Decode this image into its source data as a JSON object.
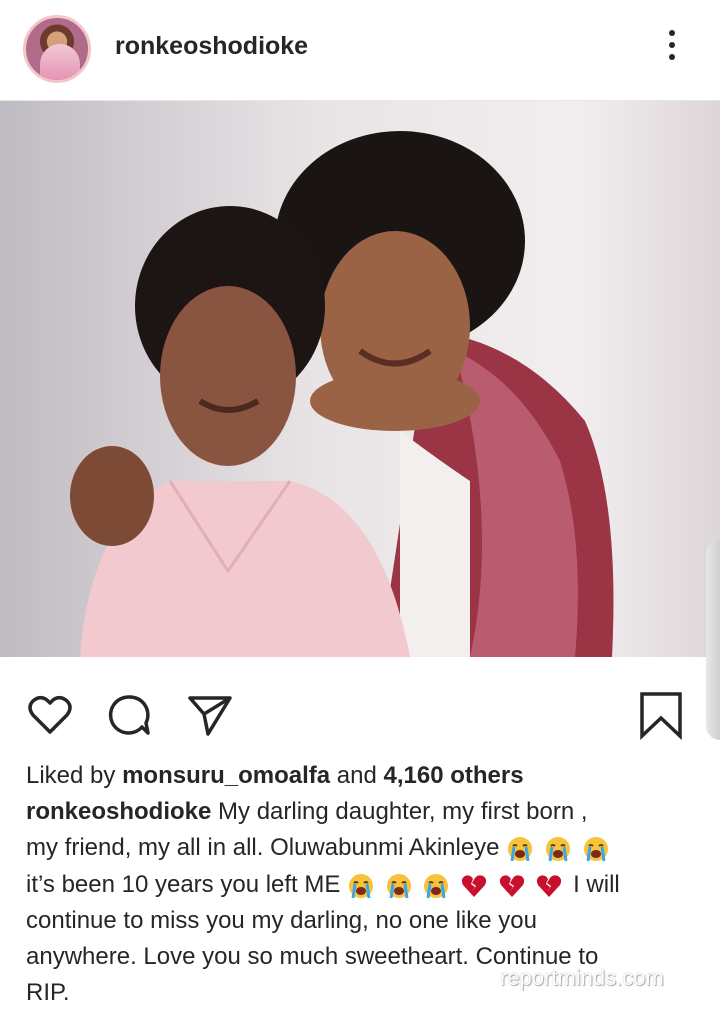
{
  "post": {
    "username": "ronkeoshodioke"
  },
  "likes": {
    "prefix": "Liked by",
    "user": "monsuru_omoalfa",
    "joiner": "and",
    "count": "4,160 others"
  },
  "caption": {
    "author": "ronkeoshodioke",
    "line1": "My darling daughter, my first born ,",
    "line2": "my friend, my all in all. Oluwabunmi Akinleye",
    "line3": "it’s been 10 years you left ME",
    "line3_end": "I will",
    "line4": "continue to miss you my darling, no one like you",
    "line5": "anywhere. Love you so much sweetheart. Continue to",
    "line6": "RIP."
  },
  "icons": {
    "like": "heart-icon",
    "comment": "comment-icon",
    "share": "send-icon",
    "save": "bookmark-icon",
    "more": "more-vertical-icon",
    "crying": "loudly-crying-face-emoji",
    "broken_heart": "broken-heart-emoji"
  },
  "watermark": "reportminds.com",
  "colors": {
    "text": "#262626",
    "divider": "#e6e6e6",
    "broken_heart": "#c8102e",
    "emoji_face": "#f7c33c"
  }
}
